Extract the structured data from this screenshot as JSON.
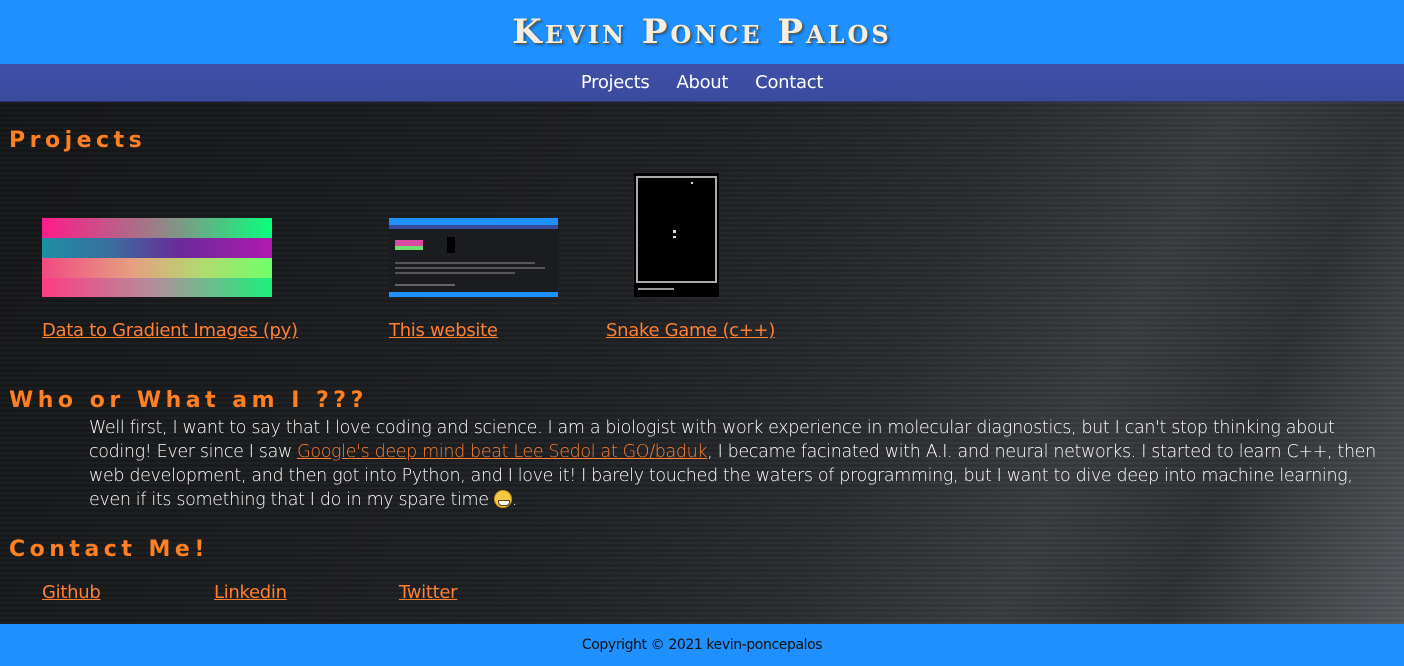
{
  "header": {
    "title": "Kevin Ponce Palos"
  },
  "nav": {
    "items": [
      "Projects",
      "About",
      "Contact"
    ]
  },
  "projects": {
    "heading": "Projects",
    "items": [
      {
        "label": "Data to Gradient Images (py)"
      },
      {
        "label": "This website"
      },
      {
        "label": "Snake Game (c++)"
      }
    ]
  },
  "about": {
    "heading": "Who or What am I ???",
    "text_before": "Well first, I want to say that I love coding and science. I am a biologist with work experience in molecular diagnostics, but I can't stop thinking about coding! Ever since I saw ",
    "link": "Google's deep mind beat Lee Sedol at GO/baduk",
    "text_after": ", I became facinated with A.I. and neural networks. I started to learn C++, then web development, and then got into Python, and I love it! I barely touched the waters of programming, but I want to dive deep into machine learning, even if its something that I do in my spare time ",
    "text_end": "."
  },
  "contact": {
    "heading": "Contact Me!",
    "links": [
      "Github",
      "Linkedin",
      "Twitter"
    ]
  },
  "footer": {
    "copyright": "Copyright © 2021 kevin-poncepalos"
  },
  "colors": {
    "brand_blue": "#1e90ff",
    "nav_blue": "#3a4a9e",
    "accent_orange": "#ff7f22"
  }
}
